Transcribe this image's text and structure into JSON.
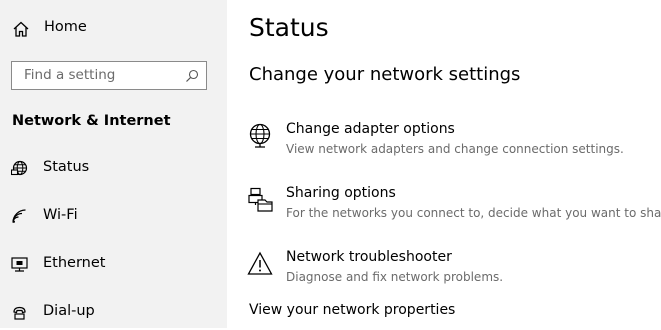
{
  "sidebar": {
    "home_label": "Home",
    "search_placeholder": "Find a setting",
    "section_title": "Network & Internet",
    "items": [
      {
        "label": "Status",
        "icon": "globe-status-icon"
      },
      {
        "label": "Wi-Fi",
        "icon": "wifi-icon"
      },
      {
        "label": "Ethernet",
        "icon": "ethernet-icon"
      },
      {
        "label": "Dial-up",
        "icon": "dialup-icon"
      }
    ]
  },
  "main": {
    "title": "Status",
    "subtitle": "Change your network settings",
    "options": [
      {
        "title": "Change adapter options",
        "description": "View network adapters and change connection settings.",
        "icon": "adapter-globe-icon"
      },
      {
        "title": "Sharing options",
        "description": "For the networks you connect to, decide what you want to share.",
        "icon": "sharing-icon"
      },
      {
        "title": "Network troubleshooter",
        "description": "Diagnose and fix network problems.",
        "icon": "warning-icon"
      }
    ],
    "properties_link": "View your network properties"
  }
}
